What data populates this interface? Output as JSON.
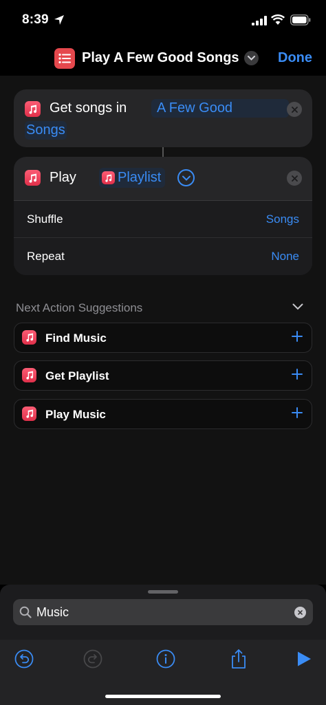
{
  "status": {
    "time": "8:39"
  },
  "nav": {
    "title": "Play A Few Good Songs",
    "done_label": "Done"
  },
  "actions": {
    "get_songs": {
      "label": "Get songs in",
      "param_line1": "A Few Good",
      "param_line2": "Songs"
    },
    "play": {
      "label": "Play",
      "input_label": "Playlist",
      "options": [
        {
          "label": "Shuffle",
          "value": "Songs"
        },
        {
          "label": "Repeat",
          "value": "None"
        }
      ]
    }
  },
  "suggestions": {
    "header": "Next Action Suggestions",
    "items": [
      {
        "label": "Find Music"
      },
      {
        "label": "Get Playlist"
      },
      {
        "label": "Play Music"
      }
    ]
  },
  "search": {
    "value": "Music"
  },
  "colors": {
    "accent": "#3a8cf5",
    "music_red": "#e5484d",
    "background": "#000000"
  }
}
